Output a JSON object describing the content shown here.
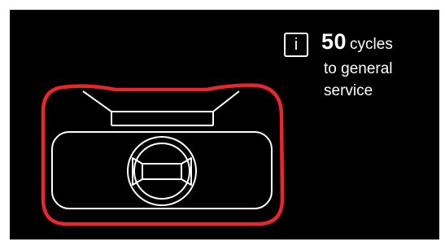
{
  "status": {
    "info_icon_glyph": "i",
    "cycle_count": "50",
    "cycle_unit": "cycles",
    "message_line_1": "to general",
    "message_line_2": "service"
  },
  "colors": {
    "background": "#000000",
    "foreground": "#ffffff",
    "alert_outline": "#e8262d"
  },
  "icons": {
    "machine": "machine-illustration-icon",
    "info": "info-icon"
  }
}
